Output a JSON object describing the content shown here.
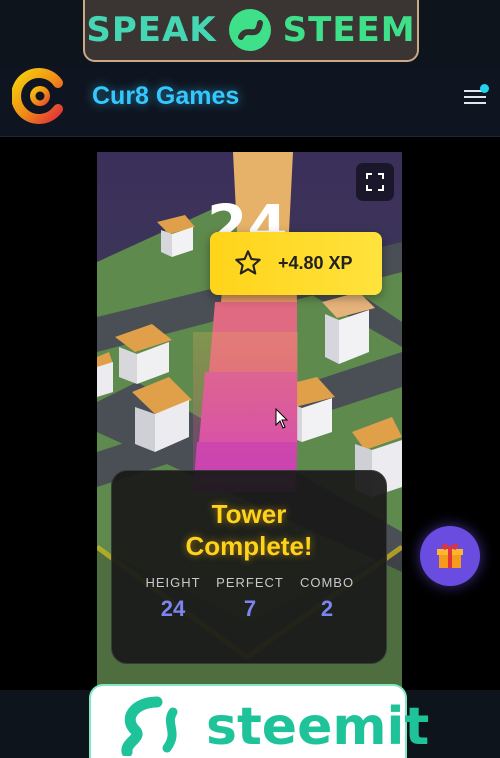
{
  "ad_top": {
    "left_word": "SPEAK",
    "right_word": "STEEM"
  },
  "header": {
    "site_title": "Cur8 Games",
    "menu_icon": "hamburger-menu-icon"
  },
  "game": {
    "current_height": "24",
    "xp_toast": {
      "text": "+4.80 XP",
      "icon": "star-icon"
    },
    "result": {
      "title_line1": "Tower",
      "title_line2": "Complete!",
      "stats": [
        {
          "label": "HEIGHT",
          "value": "24"
        },
        {
          "label": "PERFECT",
          "value": "7"
        },
        {
          "label": "COMBO",
          "value": "2"
        }
      ]
    },
    "fullscreen_icon": "fullscreen-icon"
  },
  "gift_icon": "gift-icon",
  "ad_bottom": {
    "word": "steemit"
  },
  "colors": {
    "title_accent": "#35c8ff",
    "xp_yellow": "#ffd41a",
    "result_title": "#ffd21c",
    "stat_value": "#7d86f0",
    "gift_bg": "#6a4ce0",
    "steem_green": "#1fc39a"
  }
}
